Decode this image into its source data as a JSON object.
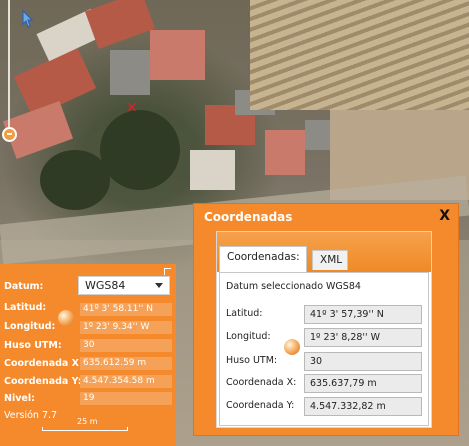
{
  "left_panel": {
    "datum_label": "Datum:",
    "datum_value": "WGS84",
    "rows": [
      {
        "label": "Latitud:",
        "value": "41º 3' 58.11'' N"
      },
      {
        "label": "Longitud:",
        "value": "1º 23' 9.34'' W"
      },
      {
        "label": "Huso UTM:",
        "value": "30"
      },
      {
        "label": "Coordenada X:",
        "value": "635.612.59 m"
      },
      {
        "label": "Coordenada Y:",
        "value": "4.547.354.58 m"
      },
      {
        "label": "Nivel:",
        "value": "19"
      }
    ],
    "version": "Versión 7.7",
    "scale_label": "25 m"
  },
  "dialog": {
    "title": "Coordenadas",
    "close_symbol": "X",
    "tabs": [
      "Coordenadas:",
      "XML"
    ],
    "datum_info": "Datum seleccionado WGS84",
    "fields": [
      {
        "label": "Latitud:",
        "value": "41º 3' 57,39'' N"
      },
      {
        "label": "Longitud:",
        "value": "1º 23' 8,28'' W"
      },
      {
        "label": "Huso UTM:",
        "value": "30"
      },
      {
        "label": "Coordenada X:",
        "value": "635.637,79 m"
      },
      {
        "label": "Coordenada Y:",
        "value": "4.547.332,82 m"
      }
    ]
  },
  "map": {
    "marker_symbol": "✕",
    "icons": [
      "pointer-icon",
      "zoom-slider-icon",
      "marker-icon"
    ]
  },
  "colors": {
    "accent": "#f48a2c",
    "value_bg": "#f5a157",
    "marker": "#e02020"
  }
}
